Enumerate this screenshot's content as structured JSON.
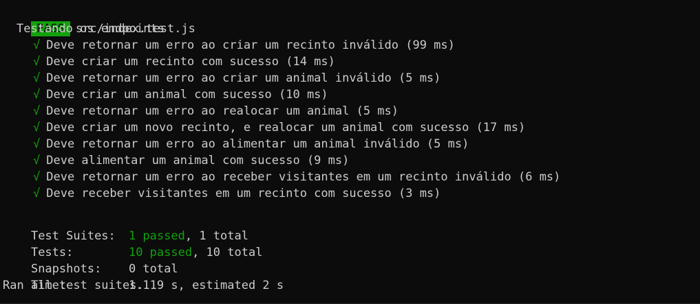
{
  "header": {
    "badge": "PASS",
    "file": "src/index.test.js"
  },
  "suite": {
    "title": "Testando os endpoints",
    "check_glyph": "√",
    "tests": [
      "Deve retornar um erro ao criar um recinto inválido (99 ms)",
      "Deve criar um recinto com sucesso (14 ms)",
      "Deve retornar um erro ao criar um animal inválido (5 ms)",
      "Deve criar um animal com sucesso (10 ms)",
      "Deve retornar um erro ao realocar um animal (5 ms)",
      "Deve criar um novo recinto, e realocar um animal com sucesso (17 ms)",
      "Deve retornar um erro ao alimentar um animal inválido (5 ms)",
      "Deve alimentar um animal com sucesso (9 ms)",
      "Deve retornar um erro ao receber visitantes em um recinto inválido (6 ms)",
      "Deve receber visitantes em um recinto com sucesso (3 ms)"
    ]
  },
  "summary": {
    "suites_label": "Test Suites:",
    "suites_passed": "1 passed",
    "suites_total": ", 1 total",
    "tests_label": "Tests:",
    "tests_passed": "10 passed",
    "tests_total": ", 10 total",
    "snapshots_label": "Snapshots:",
    "snapshots_value": "0 total",
    "time_label": "Time:",
    "time_value": "1.119 s, estimated 2 s",
    "ran": "Ran all test suites."
  },
  "colors": {
    "background": "#0c0c0c",
    "text": "#cccccc",
    "pass_green": "#13a10e"
  }
}
